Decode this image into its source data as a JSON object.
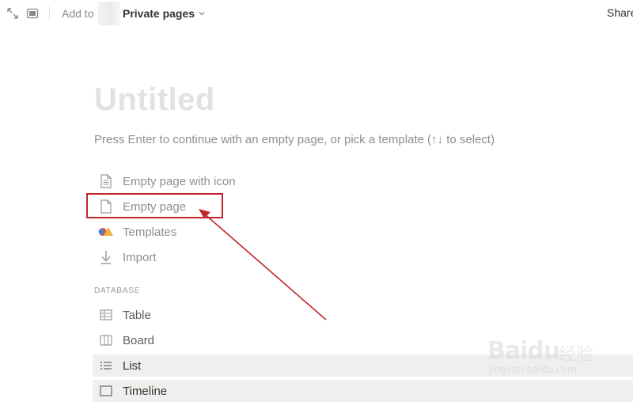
{
  "topbar": {
    "add_to": "Add to",
    "workspace": "Private pages",
    "share": "Share"
  },
  "page": {
    "title": "Untitled",
    "hint": "Press Enter to continue with an empty page, or pick a template (↑↓ to select)"
  },
  "options": [
    {
      "label": "Empty page with icon",
      "icon": "page-with-text-icon"
    },
    {
      "label": "Empty page",
      "icon": "blank-page-icon"
    },
    {
      "label": "Templates",
      "icon": "templates-shapes-icon"
    },
    {
      "label": "Import",
      "icon": "import-arrow-icon"
    }
  ],
  "database": {
    "label": "DATABASE",
    "items": [
      {
        "label": "Table",
        "icon": "table-icon"
      },
      {
        "label": "Board",
        "icon": "board-icon"
      },
      {
        "label": "List",
        "icon": "list-icon"
      },
      {
        "label": "Timeline",
        "icon": "timeline-icon"
      }
    ]
  },
  "annotation": {
    "color": "#c0262d"
  },
  "watermark": {
    "logo": "Baidu",
    "cn": "经验",
    "url": "jingyan.baidu.com"
  },
  "colors": {
    "title_placeholder": "#e3e2e0",
    "muted_text": "#8f8e8a",
    "highlight_row": "#efefee"
  }
}
